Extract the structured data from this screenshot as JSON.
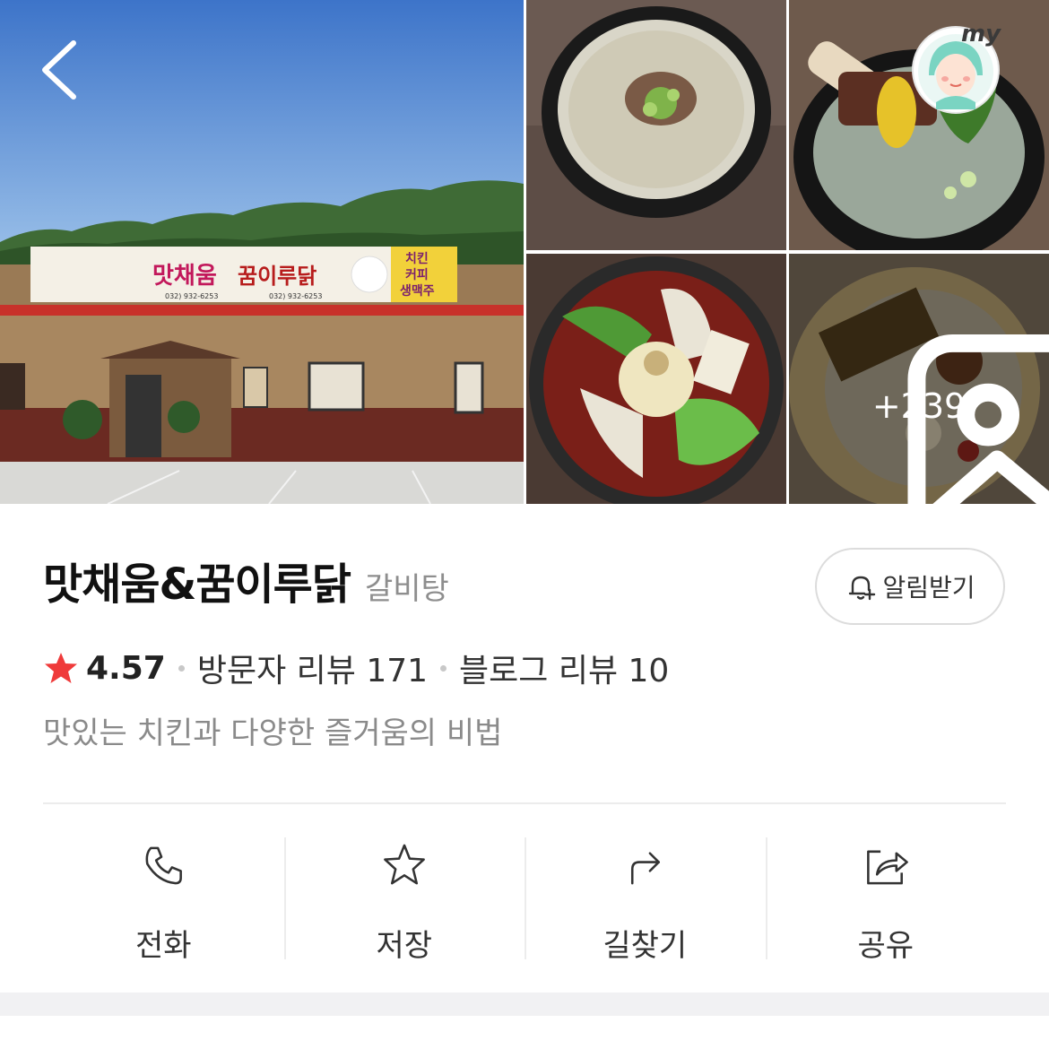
{
  "place": {
    "name": "맛채움&꿈이루닭",
    "category": "갈비탕",
    "rating": "4.57",
    "visitor_reviews": "방문자 리뷰 171",
    "blog_reviews": "블로그 리뷰 10",
    "description": "맛있는 치킨과 다양한 즐거움의 비법"
  },
  "gallery": {
    "more_count": "+239",
    "my_badge": "my",
    "signboard": {
      "main": "맛채움",
      "chicken": "꿈이루닭",
      "side": [
        "치킨",
        "커피",
        "생맥주"
      ],
      "phone1": "032) 932-6253",
      "phone2": "032) 932-6253"
    }
  },
  "buttons": {
    "alarm": "알림받기"
  },
  "actions": [
    {
      "label": "전화",
      "icon": "phone-icon"
    },
    {
      "label": "저장",
      "icon": "star-outline-icon"
    },
    {
      "label": "길찾기",
      "icon": "directions-icon"
    },
    {
      "label": "공유",
      "icon": "share-icon"
    }
  ],
  "colors": {
    "star": "#ef3a3a",
    "text_primary": "#111111",
    "text_secondary": "#8a8a8a",
    "divider": "#ececec"
  }
}
